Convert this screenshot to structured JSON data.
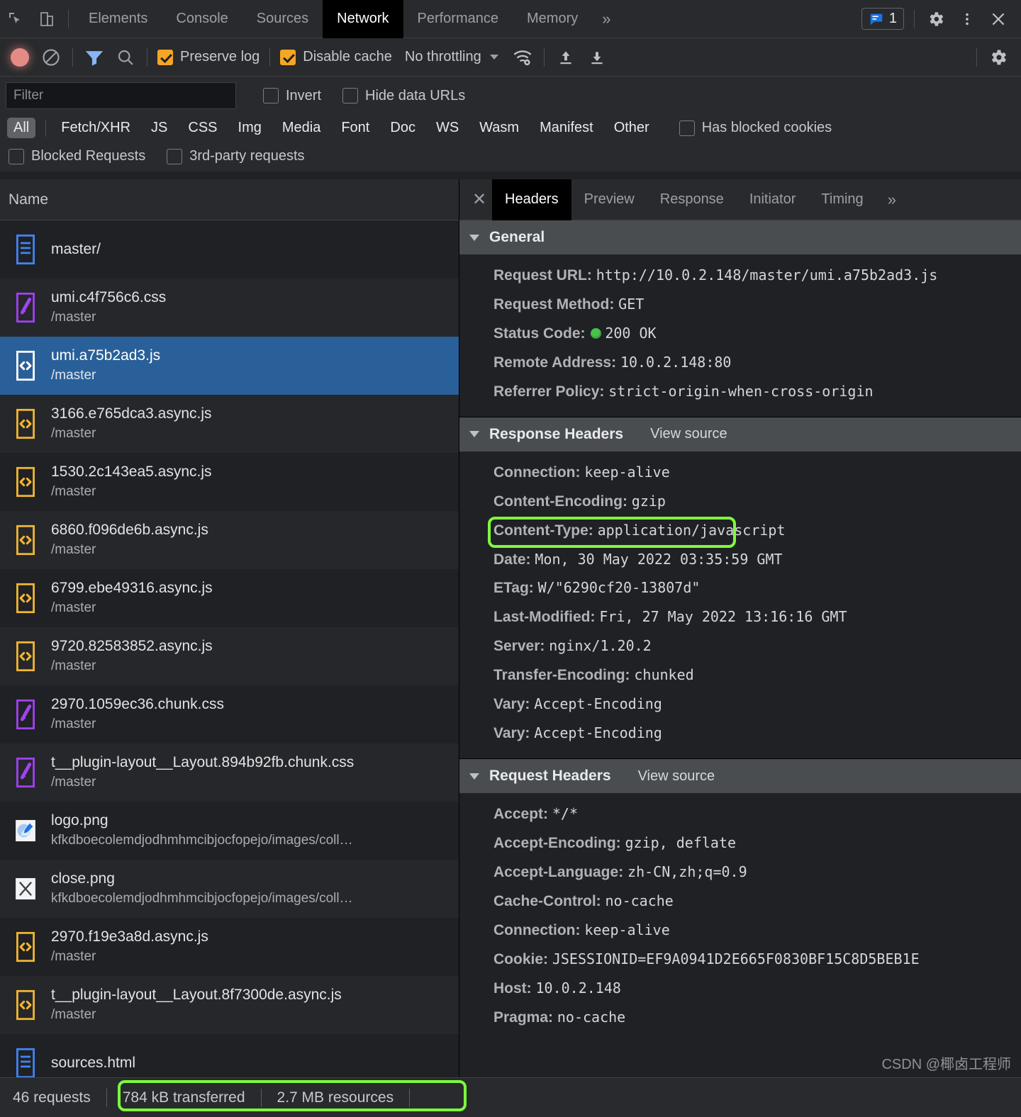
{
  "window": {
    "tabs": [
      {
        "label": "Elements",
        "active": false
      },
      {
        "label": "Console",
        "active": false
      },
      {
        "label": "Sources",
        "active": false
      },
      {
        "label": "Network",
        "active": true
      },
      {
        "label": "Performance",
        "active": false
      },
      {
        "label": "Memory",
        "active": false
      }
    ],
    "more_tabs_glyph": "»",
    "issues_count": "1"
  },
  "toolbar": {
    "preserve_log": "Preserve log",
    "preserve_log_checked": true,
    "disable_cache": "Disable cache",
    "disable_cache_checked": true,
    "throttling": "No throttling"
  },
  "filters": {
    "filter_placeholder": "Filter",
    "filter_value": "",
    "invert": "Invert",
    "hide_data_urls": "Hide data URLs",
    "types": [
      {
        "label": "All",
        "active": true
      },
      {
        "label": "Fetch/XHR",
        "active": false
      },
      {
        "label": "JS",
        "active": false
      },
      {
        "label": "CSS",
        "active": false
      },
      {
        "label": "Img",
        "active": false
      },
      {
        "label": "Media",
        "active": false
      },
      {
        "label": "Font",
        "active": false
      },
      {
        "label": "Doc",
        "active": false
      },
      {
        "label": "WS",
        "active": false
      },
      {
        "label": "Wasm",
        "active": false
      },
      {
        "label": "Manifest",
        "active": false
      },
      {
        "label": "Other",
        "active": false
      }
    ],
    "has_blocked_cookies": "Has blocked cookies",
    "blocked_requests": "Blocked Requests",
    "third_party_requests": "3rd-party requests"
  },
  "request_list": {
    "column_header": "Name",
    "rows": [
      {
        "name": "master/",
        "url": "",
        "icon": "doc-icon",
        "selected": false
      },
      {
        "name": "umi.c4f756c6.css",
        "url": "/master",
        "icon": "css-icon",
        "selected": false
      },
      {
        "name": "umi.a75b2ad3.js",
        "url": "/master",
        "icon": "js-icon-white",
        "selected": true
      },
      {
        "name": "3166.e765dca3.async.js",
        "url": "/master",
        "icon": "js-icon",
        "selected": false
      },
      {
        "name": "1530.2c143ea5.async.js",
        "url": "/master",
        "icon": "js-icon",
        "selected": false
      },
      {
        "name": "6860.f096de6b.async.js",
        "url": "/master",
        "icon": "js-icon",
        "selected": false
      },
      {
        "name": "6799.ebe49316.async.js",
        "url": "/master",
        "icon": "js-icon",
        "selected": false
      },
      {
        "name": "9720.82583852.async.js",
        "url": "/master",
        "icon": "js-icon",
        "selected": false
      },
      {
        "name": "2970.1059ec36.chunk.css",
        "url": "/master",
        "icon": "css-icon",
        "selected": false
      },
      {
        "name": "t__plugin-layout__Layout.894b92fb.chunk.css",
        "url": "/master",
        "icon": "css-icon",
        "selected": false
      },
      {
        "name": "logo.png",
        "url": "kfkdboecolemdjodhmhmcibjocfopejo/images/coll…",
        "icon": "image-logo-icon",
        "selected": false
      },
      {
        "name": "close.png",
        "url": "kfkdboecolemdjodhmhmcibjocfopejo/images/coll…",
        "icon": "image-close-icon",
        "selected": false
      },
      {
        "name": "2970.f19e3a8d.async.js",
        "url": "/master",
        "icon": "js-icon",
        "selected": false
      },
      {
        "name": "t__plugin-layout__Layout.8f7300de.async.js",
        "url": "/master",
        "icon": "js-icon",
        "selected": false
      },
      {
        "name": "sources.html",
        "url": "",
        "icon": "doc-icon",
        "selected": false
      }
    ]
  },
  "detail": {
    "tabs": [
      {
        "label": "Headers",
        "active": true
      },
      {
        "label": "Preview",
        "active": false
      },
      {
        "label": "Response",
        "active": false
      },
      {
        "label": "Initiator",
        "active": false
      },
      {
        "label": "Timing",
        "active": false
      }
    ],
    "more_glyph": "»",
    "view_source": "View source",
    "general": {
      "title": "General",
      "items": [
        {
          "key": "Request URL:",
          "value": "http://10.0.2.148/master/umi.a75b2ad3.js"
        },
        {
          "key": "Request Method:",
          "value": "GET"
        },
        {
          "key": "Status Code:",
          "value": "200 OK",
          "status_dot": true
        },
        {
          "key": "Remote Address:",
          "value": "10.0.2.148:80"
        },
        {
          "key": "Referrer Policy:",
          "value": "strict-origin-when-cross-origin"
        }
      ]
    },
    "response_headers": {
      "title": "Response Headers",
      "items": [
        {
          "key": "Connection:",
          "value": "keep-alive"
        },
        {
          "key": "Content-Encoding:",
          "value": "gzip",
          "highlighted": true
        },
        {
          "key": "Content-Type:",
          "value": "application/javascript"
        },
        {
          "key": "Date:",
          "value": "Mon, 30 May 2022 03:35:59 GMT"
        },
        {
          "key": "ETag:",
          "value": "W/\"6290cf20-13807d\""
        },
        {
          "key": "Last-Modified:",
          "value": "Fri, 27 May 2022 13:16:16 GMT"
        },
        {
          "key": "Server:",
          "value": "nginx/1.20.2"
        },
        {
          "key": "Transfer-Encoding:",
          "value": "chunked"
        },
        {
          "key": "Vary:",
          "value": "Accept-Encoding"
        },
        {
          "key": "Vary:",
          "value": "Accept-Encoding"
        }
      ]
    },
    "request_headers": {
      "title": "Request Headers",
      "items": [
        {
          "key": "Accept:",
          "value": "*/*"
        },
        {
          "key": "Accept-Encoding:",
          "value": "gzip, deflate"
        },
        {
          "key": "Accept-Language:",
          "value": "zh-CN,zh;q=0.9"
        },
        {
          "key": "Cache-Control:",
          "value": "no-cache"
        },
        {
          "key": "Connection:",
          "value": "keep-alive"
        },
        {
          "key": "Cookie:",
          "value": "JSESSIONID=EF9A0941D2E665F0830BF15C8D5BEB1E"
        },
        {
          "key": "Host:",
          "value": "10.0.2.148"
        },
        {
          "key": "Pragma:",
          "value": "no-cache"
        }
      ]
    }
  },
  "statusbar": {
    "requests": "46 requests",
    "transferred": "784 kB transferred",
    "resources": "2.7 MB resources"
  },
  "watermark": "CSDN @椰卤工程师",
  "colors": {
    "accent_selected_row": "#2a6099",
    "checkbox_on": "#f5a623",
    "highlight_green": "#7cfc3c",
    "status_ok_green": "#49c24a",
    "active_tab_bg": "#000000"
  }
}
